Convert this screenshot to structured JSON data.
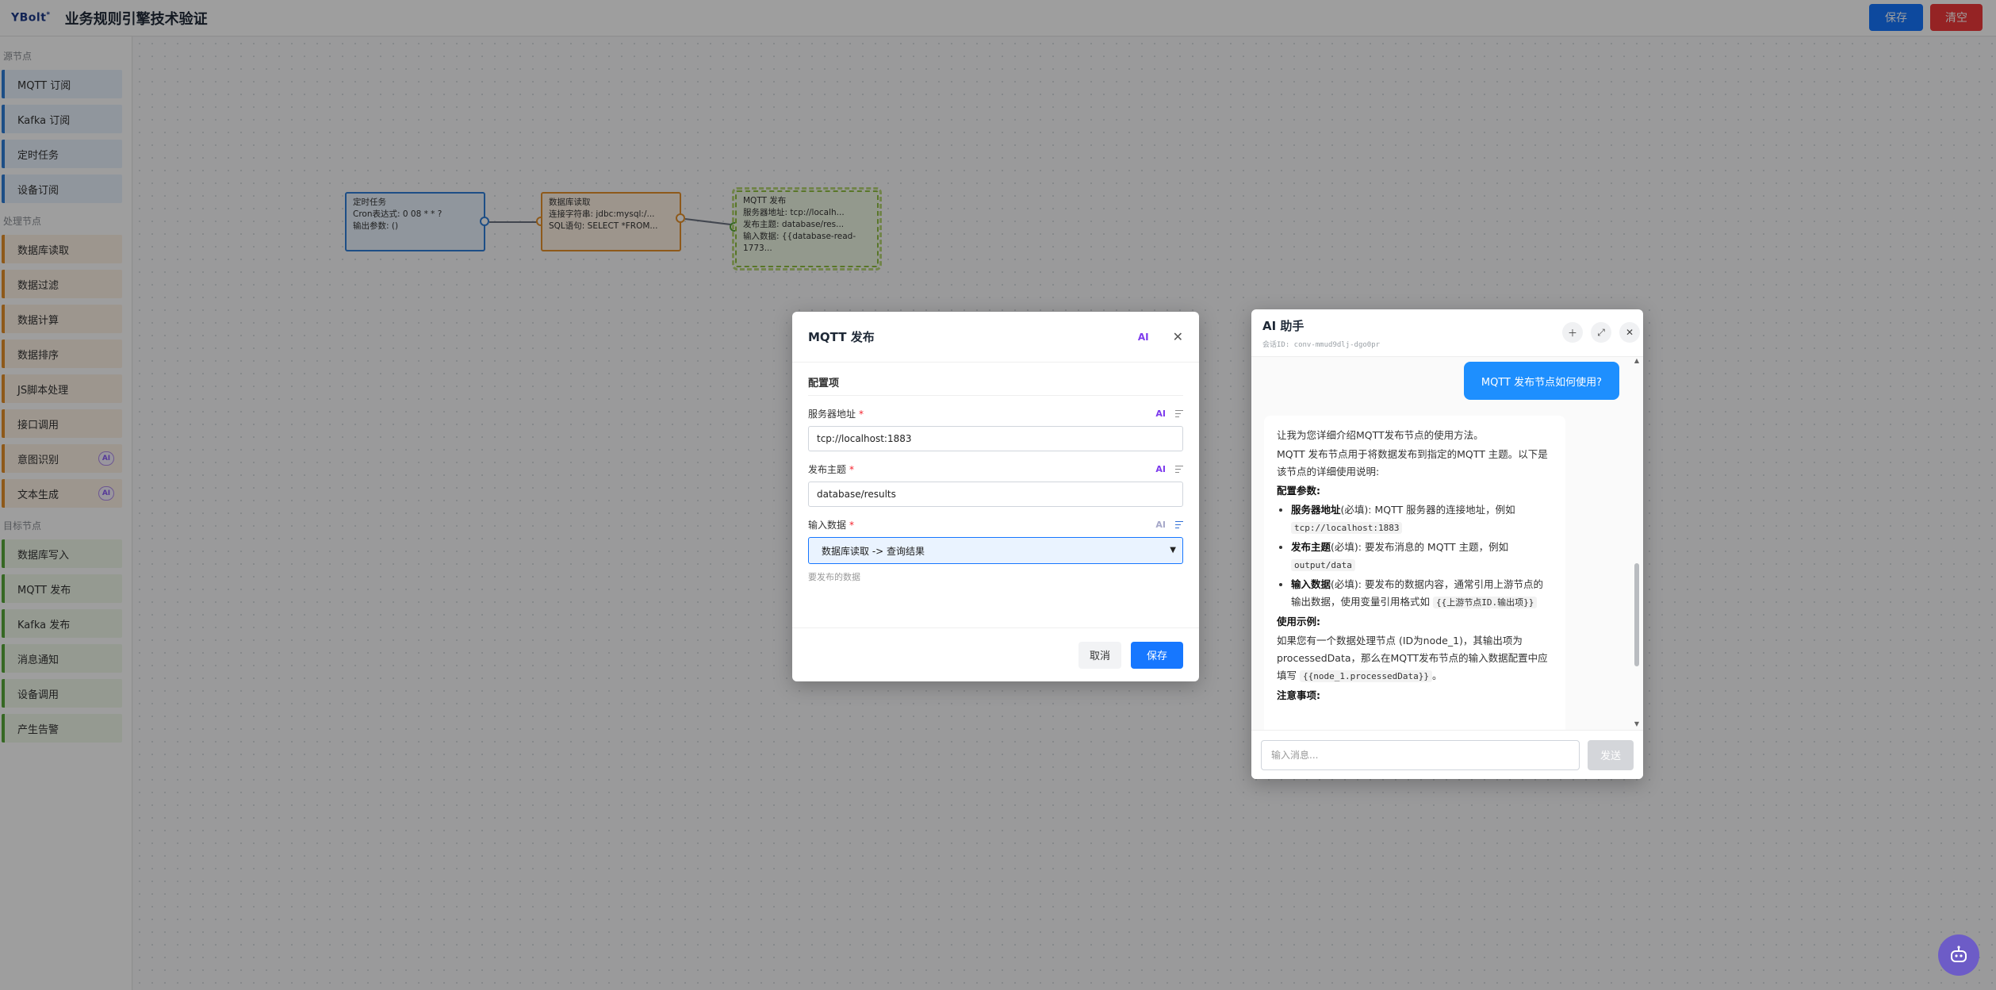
{
  "app": {
    "logo_text": "YBolt",
    "logo_mark": "*",
    "title": "业务规则引擎技术验证",
    "save_label": "保存",
    "clear_label": "清空"
  },
  "sidebar": {
    "sections": {
      "source": {
        "title": "源节点",
        "items": [
          "MQTT 订阅",
          "Kafka 订阅",
          "定时任务",
          "设备订阅"
        ]
      },
      "process": {
        "title": "处理节点",
        "items": [
          "数据库读取",
          "数据过滤",
          "数据计算",
          "数据排序",
          "JS脚本处理",
          "接口调用",
          "意图识别",
          "文本生成"
        ],
        "ai_badge": "AI"
      },
      "target": {
        "title": "目标节点",
        "items": [
          "数据库写入",
          "MQTT 发布",
          "Kafka 发布",
          "消息通知",
          "设备调用",
          "产生告警"
        ]
      }
    }
  },
  "canvas": {
    "nodes": [
      {
        "id": "timer",
        "lines": [
          "定时任务",
          "Cron表达式: 0 08 * * ?",
          "输出参数: ()"
        ]
      },
      {
        "id": "db",
        "lines": [
          "数据库读取",
          "连接字符串: jdbc:mysql:/...",
          "SQL语句: SELECT *FROM..."
        ]
      },
      {
        "id": "mqtt",
        "lines": [
          "MQTT 发布",
          "服务器地址: tcp://localh...",
          "发布主题: database/res...",
          "输入数据: {{database-read-1773..."
        ]
      }
    ]
  },
  "modal": {
    "title": "MQTT 发布",
    "ai_label": "AI",
    "section_title": "配置项",
    "fields": {
      "server": {
        "label": "服务器地址",
        "value": "tcp://localhost:1883"
      },
      "topic": {
        "label": "发布主题",
        "value": "database/results"
      },
      "input": {
        "label": "输入数据",
        "value": "数据库读取 -> 查询结果",
        "hint": "要发布的数据"
      }
    },
    "required_mark": "*",
    "field_ai_label": "AI",
    "cancel_label": "取消",
    "save_label": "保存"
  },
  "assistant": {
    "title": "AI 助手",
    "conversation_id": "会话ID: conv-mmud9dlj-dgo0pr",
    "user_message": "MQTT 发布节点如何使用?",
    "reply": {
      "intro": "让我为您详细介绍MQTT发布节点的使用方法。",
      "desc": "MQTT 发布节点用于将数据发布到指定的MQTT 主题。以下是该节点的详细使用说明:",
      "config_heading": "配置参数:",
      "params": [
        {
          "name": "服务器地址",
          "text": "(必填): MQTT 服务器的连接地址，例如",
          "code": "tcp://localhost:1883"
        },
        {
          "name": "发布主题",
          "text": "(必填): 要发布消息的 MQTT 主题，例如",
          "code": "output/data"
        },
        {
          "name": "输入数据",
          "text": "(必填): 要发布的数据内容，通常引用上游节点的输出数据，使用变量引用格式如",
          "code": "{{上游节点ID.输出项}}"
        }
      ],
      "example_heading": "使用示例:",
      "example_text": "如果您有一个数据处理节点 (ID为node_1)，其输出项为processedData，那么在MQTT发布节点的输入数据配置中应填写",
      "example_code": "{{node_1.processedData}}",
      "example_end": "。",
      "notes_heading": "注意事项:"
    },
    "input_placeholder": "输入消息...",
    "send_label": "发送"
  },
  "colors": {
    "primary": "#1677ff",
    "danger": "#f0393b",
    "ai_purple": "#7c3aed",
    "source": "#2f7ed8",
    "process": "#e5902b",
    "target": "#58a839"
  }
}
